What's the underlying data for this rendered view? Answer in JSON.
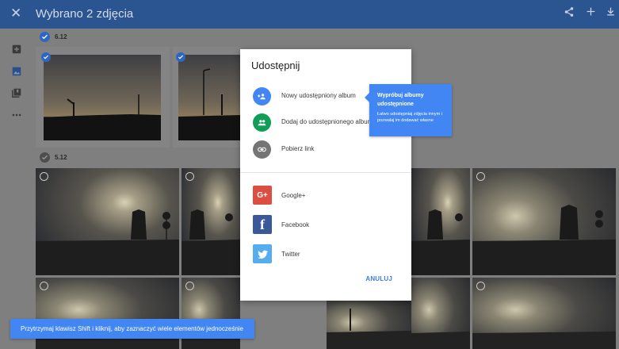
{
  "header": {
    "title": "Wybrano 2 zdjęcia",
    "close_icon": "close-icon",
    "actions": [
      "share-icon",
      "add-icon",
      "download-icon"
    ]
  },
  "sidebar": {
    "items": [
      "assistant-icon",
      "photos-icon",
      "albums-icon",
      "more-icon"
    ]
  },
  "groups": [
    {
      "date": "6.12",
      "selected": true
    },
    {
      "date": "5.12",
      "selected": false
    }
  ],
  "dialog": {
    "title": "Udostępnij",
    "options": [
      {
        "label": "Nowy udostępniony album",
        "icon": "group-add-icon",
        "color": "#4285f4"
      },
      {
        "label": "Dodaj do udostępnionego albumu",
        "icon": "group-icon",
        "color": "#0f9d58"
      },
      {
        "label": "Pobierz link",
        "icon": "link-icon",
        "color": "#757575"
      }
    ],
    "social": [
      {
        "label": "Google+",
        "icon": "google-plus-icon",
        "color": "#dc4e41",
        "glyph": "G+"
      },
      {
        "label": "Facebook",
        "icon": "facebook-icon",
        "color": "#3b5998",
        "glyph": "f"
      },
      {
        "label": "Twitter",
        "icon": "twitter-icon",
        "color": "#55acee"
      }
    ],
    "cancel_label": "ANULUJ"
  },
  "tooltip": {
    "title": "Wypróbuj albumy udostępnione",
    "body": "Łatwo udostępniaj zdjęcia innym i pozwalaj im dodawać własne"
  },
  "toast": {
    "text": "Przytrzymaj klawisz Shift i kliknij, aby zaznaczyć wiele elementów jednocześnie"
  },
  "colors": {
    "header": "#2b5591",
    "accent": "#4286f4",
    "overlay": "#7f7f7f"
  }
}
